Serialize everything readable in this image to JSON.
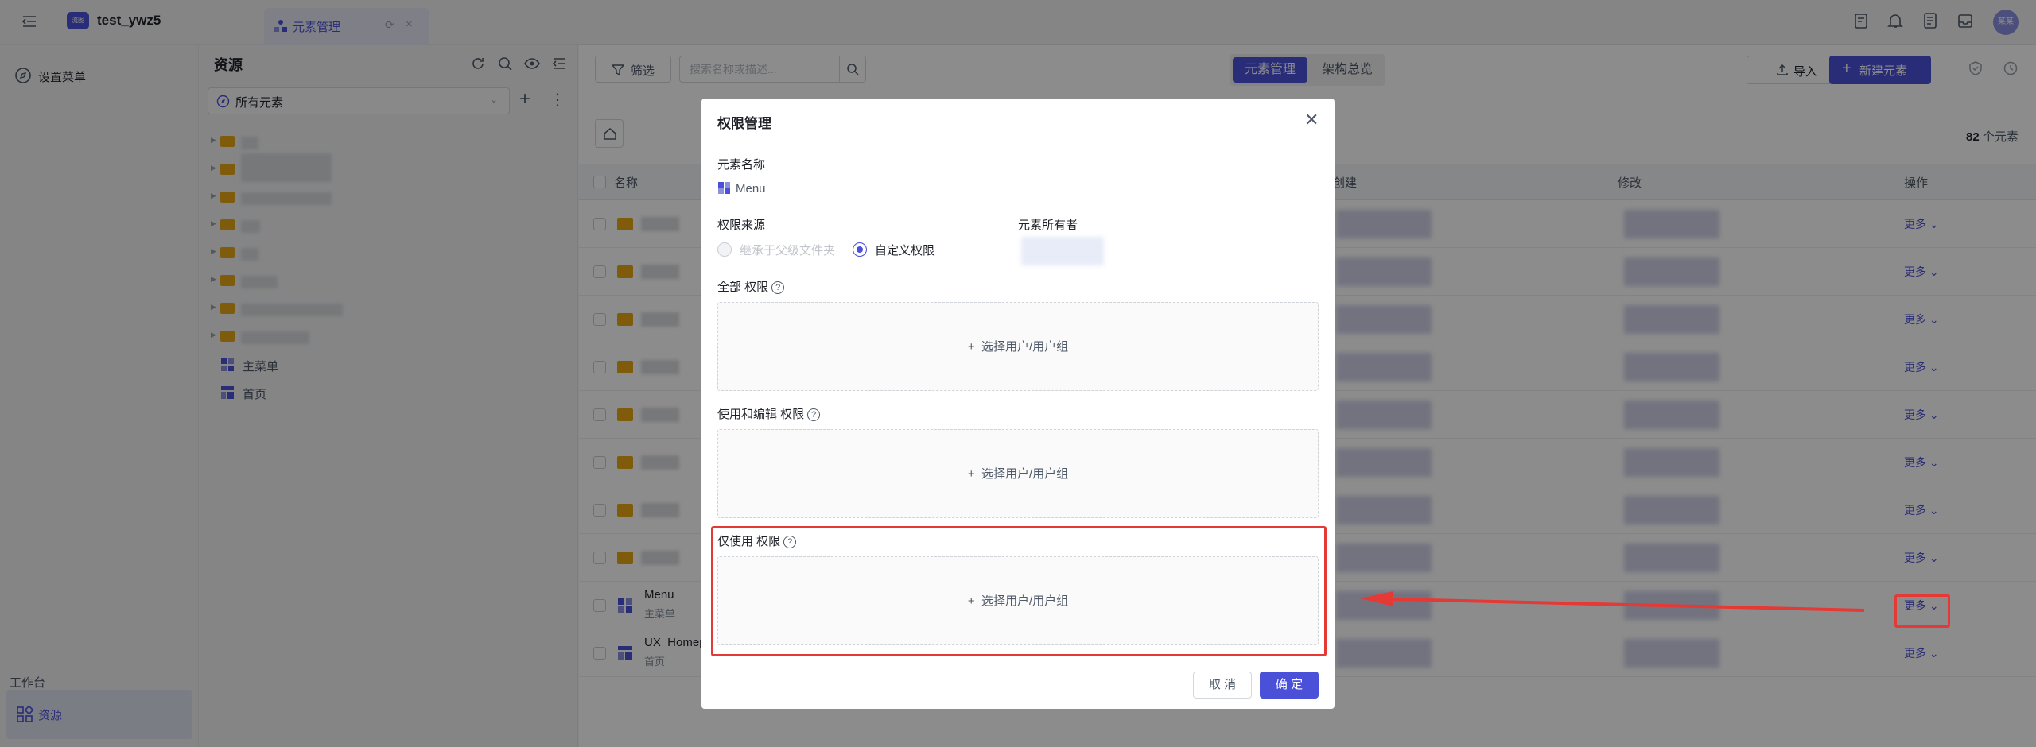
{
  "header": {
    "logo_text": "流图",
    "app_name": "test_ywz5",
    "tab": {
      "label": "元素管理"
    },
    "avatar_text": "某某",
    "icons": [
      "menu-toggle-icon",
      "form-icon",
      "bell-icon",
      "doc-icon",
      "inbox-icon"
    ]
  },
  "sidebar": {
    "settings_label": "设置菜单",
    "workspace_label": "工作台",
    "resources_label": "资源"
  },
  "resource_panel": {
    "title": "资源",
    "select_label": "所有元素",
    "tree_items": [
      {
        "label": "主菜单",
        "icon": "menu-grid-icon"
      },
      {
        "label": "首页",
        "icon": "layout-icon"
      }
    ]
  },
  "toolbar": {
    "filter_label": "筛选",
    "search_placeholder": "搜索名称或描述...",
    "seg_active": "元素管理",
    "seg_inactive": "架构总览",
    "import_label": "导入",
    "new_label": "新建元素"
  },
  "list": {
    "count_number": "82",
    "count_unit": "个元素",
    "columns": [
      "名称",
      "创建",
      "修改",
      "操作"
    ],
    "more_label": "更多",
    "named_rows": [
      {
        "name": "Menu",
        "sub": "主菜单"
      },
      {
        "name": "UX_Homep",
        "sub": "首页"
      }
    ]
  },
  "dialog": {
    "title": "权限管理",
    "element_name_label": "元素名称",
    "element_name_value": "Menu",
    "source_label": "权限来源",
    "source_option_inherit": "继承于父级文件夹",
    "source_option_custom": "自定义权限",
    "owner_label": "元素所有者",
    "section_all": "全部 权限",
    "section_edit": "使用和编辑 权限",
    "section_use": "仅使用 权限",
    "select_users": "选择用户/用户组",
    "cancel": "取 消",
    "ok": "确 定"
  },
  "colors": {
    "accent": "#4b50d8",
    "folder": "#e6a817",
    "highlight": "#e53935"
  }
}
